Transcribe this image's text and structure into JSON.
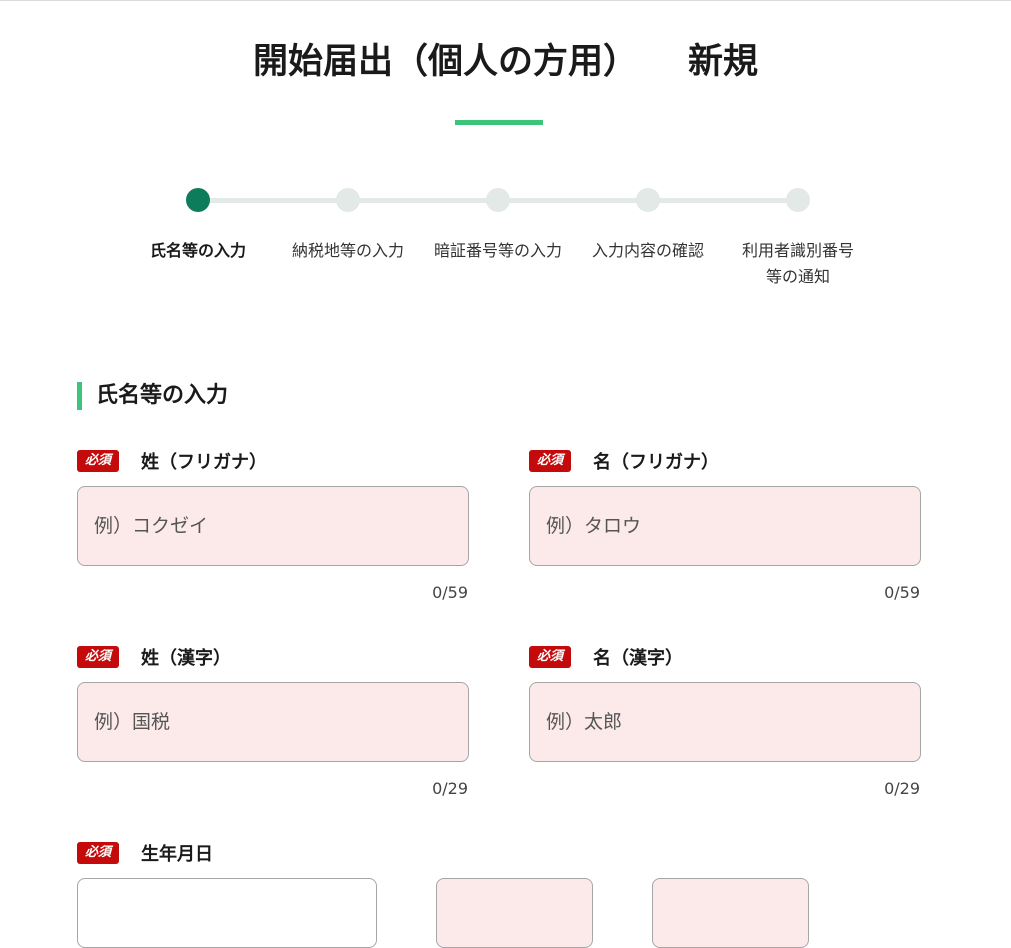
{
  "header": {
    "title": "開始届出（個人の方用）",
    "mode": "新規"
  },
  "stepper": {
    "steps": [
      {
        "label": "氏名等の入力",
        "active": true
      },
      {
        "label": "納税地等の入力",
        "active": false
      },
      {
        "label": "暗証番号等の入力",
        "active": false
      },
      {
        "label": "入力内容の確認",
        "active": false
      },
      {
        "label": "利用者識別番号",
        "label2": "等の通知",
        "active": false
      }
    ]
  },
  "section": {
    "title": "氏名等の入力"
  },
  "required_badge": "必須",
  "fields": {
    "sei_kana": {
      "label": "姓（フリガナ）",
      "placeholder": "例）コクゼイ",
      "value": "",
      "count": "0/59"
    },
    "mei_kana": {
      "label": "名（フリガナ）",
      "placeholder": "例）タロウ",
      "value": "",
      "count": "0/59"
    },
    "sei_kanji": {
      "label": "姓（漢字）",
      "placeholder": "例）国税",
      "value": "",
      "count": "0/29"
    },
    "mei_kanji": {
      "label": "名（漢字）",
      "placeholder": "例）太郎",
      "value": "",
      "count": "0/29"
    },
    "birthdate": {
      "label": "生年月日"
    }
  },
  "colors": {
    "accent_green": "#3cc47c",
    "active_step": "#0c7c5a",
    "inactive_step": "#e3e9e7",
    "required_red": "#c40a0a",
    "input_bg": "#fceaea"
  }
}
